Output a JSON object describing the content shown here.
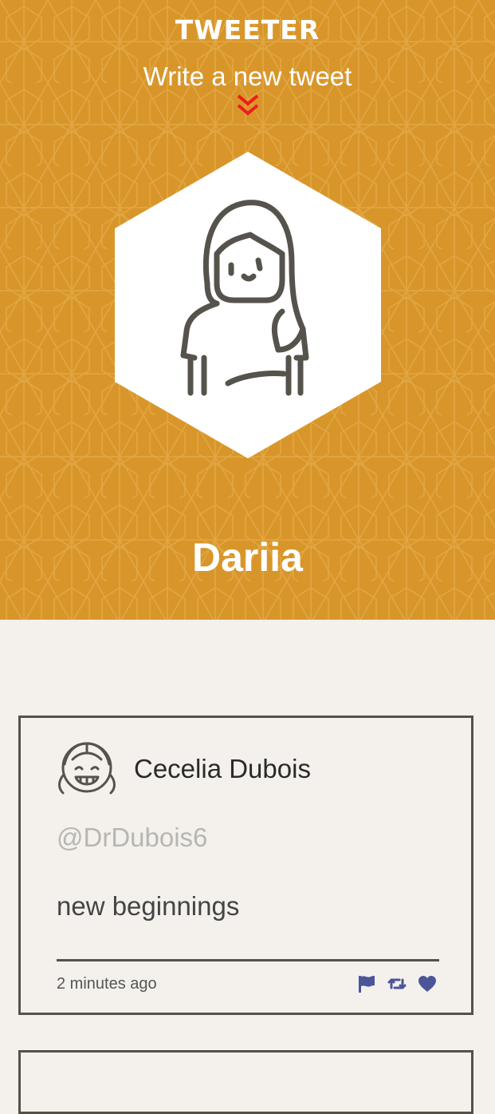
{
  "header": {
    "brand": "TWEETER",
    "compose_label": "Write a new tweet",
    "profile_name": "Dariia",
    "background_color": "#d8962a",
    "avatar_icon": "woman-avatar-icon",
    "toggle_icon": "double-chevron-down-icon",
    "toggle_icon_color": "#ee1c1c"
  },
  "tweets": [
    {
      "author_name": "Cecelia Dubois",
      "handle": "@DrDubois6",
      "content": "new beginnings",
      "timestamp": "2 minutes ago",
      "avatar_icon": "girl-avatar-icon",
      "actions": [
        "flag-icon",
        "retweet-icon",
        "heart-icon"
      ],
      "action_color": "#4a559a"
    }
  ],
  "colors": {
    "page_background": "#f4f1ec",
    "card_border": "#545149"
  }
}
